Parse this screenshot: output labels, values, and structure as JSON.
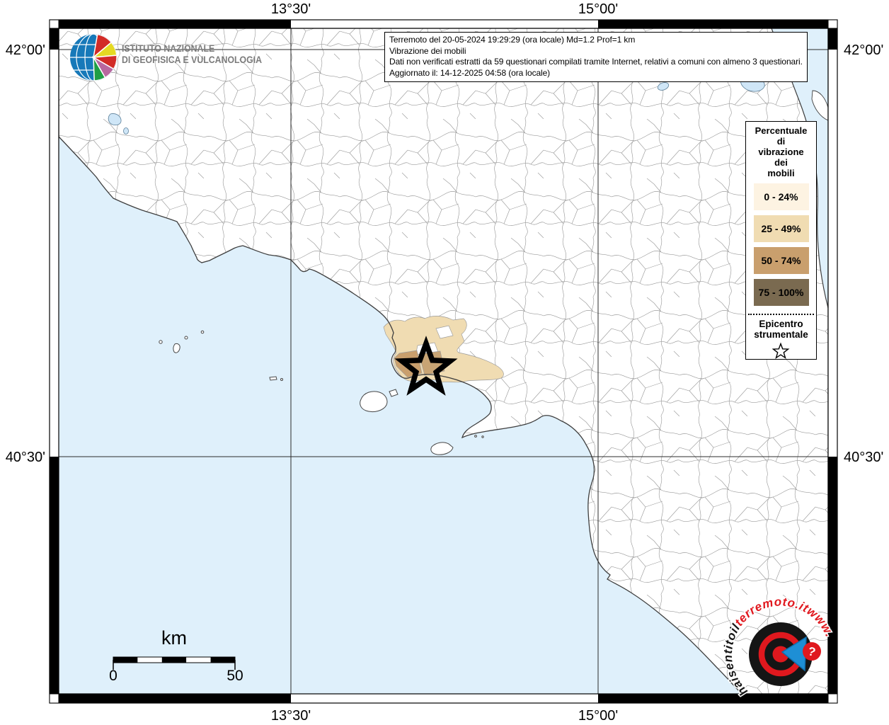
{
  "header": {
    "title_lines": [
      "Terremoto del 20-05-2024 19:29:29 (ora locale) Md=1.2 Prof=1 km",
      "Vibrazione dei mobili",
      "Dati non verificati estratti da 59 questionari compilati tramite Internet, relativi a comuni con almeno 3 questionari.",
      "Aggiornato il: 14-12-2025 04:58 (ora locale)"
    ]
  },
  "logo_ingv": {
    "line1": "ISTITUTO NAZIONALE",
    "line2": "DI GEOFISICA E VULCANOLOGIA"
  },
  "axis_labels": {
    "top_left_lon": "13°30'",
    "top_right_lon": "15°00'",
    "bottom_left_lon": "13°30'",
    "bottom_right_lon": "15°00'",
    "left_top_lat": "42°00'",
    "left_bottom_lat": "40°30'",
    "right_top_lat": "42°00'",
    "right_bottom_lat": "40°30'"
  },
  "legend": {
    "title_lines": [
      "Percentuale",
      "di",
      "vibrazione",
      "dei",
      "mobili"
    ],
    "classes": [
      {
        "label": "0 - 24%",
        "color": "#fdf3e2"
      },
      {
        "label": "25 - 49%",
        "color": "#f0dcb2"
      },
      {
        "label": "50 - 74%",
        "color": "#c99f6d"
      },
      {
        "label": "75 - 100%",
        "color": "#7a6a50"
      }
    ],
    "epicenter_line1": "Epicentro",
    "epicenter_line2": "strumentale"
  },
  "scalebar": {
    "unit": "km",
    "min": "0",
    "max": "50"
  },
  "watermark": {
    "part_black": "haisentitoil",
    "part_red": "terremoto.it",
    "part_www": "www.",
    "question_mark": "?"
  },
  "colors": {
    "sea": "#dff0fb",
    "land": "#ffffff",
    "boundary": "#9b9b9b",
    "coast": "#3f3f3f",
    "star": "#000000",
    "watermark_red": "#e0181e",
    "watermark_blue": "#1e8fd5"
  }
}
